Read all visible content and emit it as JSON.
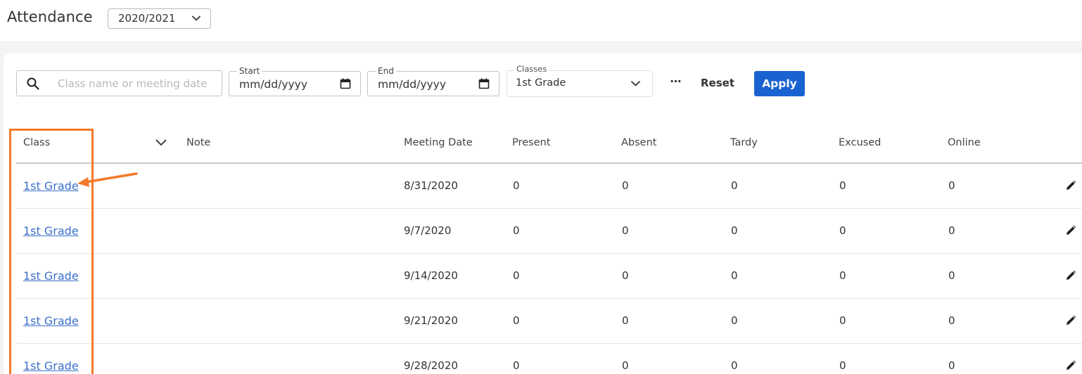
{
  "header": {
    "title": "Attendance",
    "school_year": "2020/2021"
  },
  "filters": {
    "search_placeholder": "Class name or meeting date",
    "start": {
      "label": "Start",
      "value": "mm/dd/yyyy"
    },
    "end": {
      "label": "End",
      "value": "mm/dd/yyyy"
    },
    "classes": {
      "label": "Classes",
      "value": "1st Grade"
    },
    "more_label": "⋯",
    "reset_label": "Reset",
    "apply_label": "Apply"
  },
  "table": {
    "columns": [
      "Class",
      "Note",
      "Meeting Date",
      "Present",
      "Absent",
      "Tardy",
      "Excused",
      "Online"
    ],
    "rows": [
      {
        "class": "1st Grade",
        "note": "",
        "date": "8/31/2020",
        "present": "0",
        "absent": "0",
        "tardy": "0",
        "excused": "0",
        "online": "0"
      },
      {
        "class": "1st Grade",
        "note": "",
        "date": "9/7/2020",
        "present": "0",
        "absent": "0",
        "tardy": "0",
        "excused": "0",
        "online": "0"
      },
      {
        "class": "1st Grade",
        "note": "",
        "date": "9/14/2020",
        "present": "0",
        "absent": "0",
        "tardy": "0",
        "excused": "0",
        "online": "0"
      },
      {
        "class": "1st Grade",
        "note": "",
        "date": "9/21/2020",
        "present": "0",
        "absent": "0",
        "tardy": "0",
        "excused": "0",
        "online": "0"
      },
      {
        "class": "1st Grade",
        "note": "",
        "date": "9/28/2020",
        "present": "0",
        "absent": "0",
        "tardy": "0",
        "excused": "0",
        "online": "0"
      }
    ]
  },
  "colors": {
    "accent": "#1a62d1",
    "link": "#3b6fc9",
    "annotation": "#f37a2a"
  },
  "icons": {
    "search": "search-icon",
    "calendar": "calendar-icon",
    "chevron": "chevron-down-icon",
    "edit": "pencil-icon"
  }
}
